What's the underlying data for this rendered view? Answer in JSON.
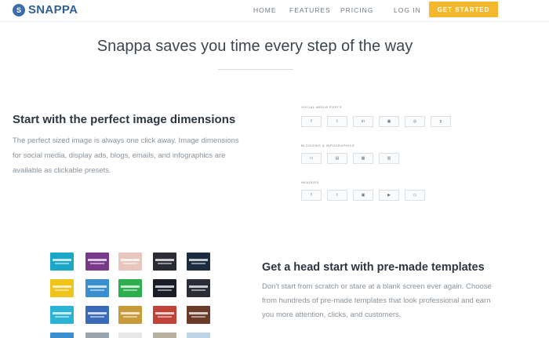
{
  "header": {
    "logo_mark": "S",
    "logo_text": "SNAPPA",
    "nav": {
      "home": "HOME",
      "features": "FEATURES",
      "pricing": "PRICING",
      "login": "LOG IN"
    },
    "cta": "GET STARTED"
  },
  "hero": {
    "title": "Snappa saves you time every step of the way"
  },
  "section_dimensions": {
    "title": "Start with the perfect image dimensions",
    "text": "The perfect sized image is always one click away. Image dimensions for social media, display ads, blogs, emails, and infographics are available as clickable presets.",
    "groups": [
      {
        "label": "SOCIAL MEDIA POSTS",
        "items": [
          {
            "icon": "f",
            "name": "facebook-icon"
          },
          {
            "icon": "t",
            "name": "twitter-icon"
          },
          {
            "icon": "in",
            "name": "linkedin-icon"
          },
          {
            "icon": "▣",
            "name": "image-icon"
          },
          {
            "icon": "◎",
            "name": "instagram-icon"
          },
          {
            "icon": "p",
            "name": "pinterest-icon"
          }
        ]
      },
      {
        "label": "BLOGGING & INFOGRAPHICS",
        "items": [
          {
            "icon": "▭",
            "name": "blog-icon"
          },
          {
            "icon": "▤",
            "name": "post-icon"
          },
          {
            "icon": "▦",
            "name": "infographic-icon"
          },
          {
            "icon": "▥",
            "name": "email-icon"
          }
        ]
      },
      {
        "label": "HEADERS",
        "items": [
          {
            "icon": "f",
            "name": "facebook-cover-icon"
          },
          {
            "icon": "t",
            "name": "twitter-header-icon"
          },
          {
            "icon": "▣",
            "name": "banner-icon"
          },
          {
            "icon": "▶",
            "name": "youtube-icon"
          },
          {
            "icon": "▭",
            "name": "display-ad-icon"
          }
        ]
      }
    ]
  },
  "section_templates": {
    "title": "Get a head start with pre-made templates",
    "text": "Don't start from scratch or stare at a blank screen ever again. Choose from hundreds of pre-made templates that look professional and earn you more attention, clicks, and customers.",
    "colors": [
      [
        "#1aa7c8",
        "#7a3a8c",
        "#e8c6c0",
        "#2b2b33",
        "#1b2b40"
      ],
      [
        "#f0c419",
        "#3a8fd0",
        "#2fae4e",
        "#1b1e28",
        "#2a2d38"
      ],
      [
        "#2bb3d6",
        "#3a6bb8",
        "#c89a3a",
        "#c0433a",
        "#6a3a2a"
      ],
      [
        "#3a8fd0",
        "#9aa4ad",
        "#e8e8e8",
        "#b8b0a0",
        "#bcd4e6"
      ]
    ]
  }
}
